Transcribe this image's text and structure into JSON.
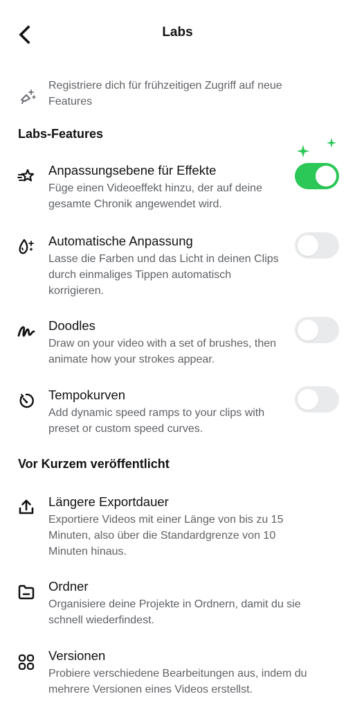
{
  "header": {
    "title": "Labs"
  },
  "intro": {
    "text": "Registriere dich für frühzeitigen Zugriff auf neue Features"
  },
  "labs_section": {
    "title": "Labs-Features",
    "items": [
      {
        "title": "Anpassungsebene für Effekte",
        "desc": "Füge einen Videoeffekt hinzu, der auf deine gesamte Chronik angewendet wird.",
        "enabled": true,
        "icon": "stars-layer-icon"
      },
      {
        "title": "Automatische Anpassung",
        "desc": "Lasse die Farben und das Licht in deinen Clips durch einmaliges Tippen automatisch korrigieren.",
        "enabled": false,
        "icon": "magic-drop-icon"
      },
      {
        "title": "Doodles",
        "desc": "Draw on your video with a set of brushes, then animate how your strokes appear.",
        "enabled": false,
        "icon": "squiggle-icon"
      },
      {
        "title": "Tempokurven",
        "desc": "Add dynamic speed ramps to your clips with preset or custom speed curves.",
        "enabled": false,
        "icon": "speed-dial-icon"
      }
    ]
  },
  "released_section": {
    "title": "Vor Kurzem veröffentlicht",
    "items": [
      {
        "title": "Längere Exportdauer",
        "desc": "Exportiere Videos mit einer Länge von bis zu 15 Minuten, also über die Standardgrenze von 10 Minuten hinaus.",
        "icon": "upload-icon"
      },
      {
        "title": "Ordner",
        "desc": "Organisiere deine Projekte in Ordnern, damit du sie schnell wiederfindest.",
        "icon": "folder-icon"
      },
      {
        "title": "Versionen",
        "desc": "Probiere verschiedene Bearbeitungen aus, indem du mehrere Versionen eines Videos erstellst.",
        "icon": "versions-grid-icon"
      }
    ]
  },
  "colors": {
    "toggle_on": "#2cc857",
    "toggle_off": "#e9eaec",
    "sparkle": "#2cc857",
    "description_text": "#5f6165"
  }
}
